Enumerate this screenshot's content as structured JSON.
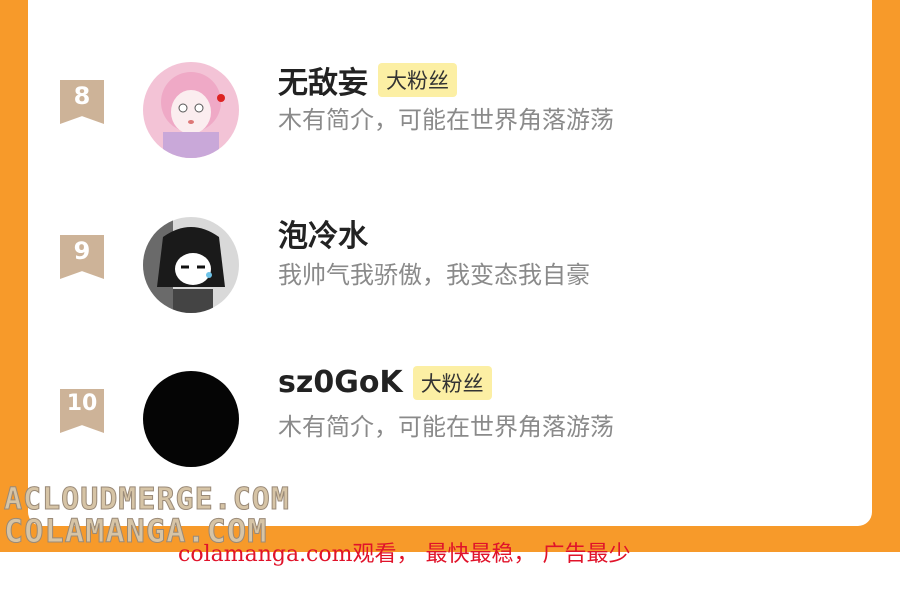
{
  "colors": {
    "frame": "#F79A2A",
    "badge": "#CDB398",
    "fan_tag_bg": "#FCEFA4",
    "ad_text": "#E0132A"
  },
  "fans": [
    {
      "rank": "8",
      "name": "无敌妄",
      "tag": "大粉丝",
      "bio": "木有简介，可能在世界角落游荡",
      "avatar_icon": "pink-anime-girl-avatar"
    },
    {
      "rank": "9",
      "name": "泡冷水",
      "tag": "",
      "bio": "我帅气我骄傲，我变态我自豪",
      "avatar_icon": "dark-hair-anime-avatar"
    },
    {
      "rank": "10",
      "name": "sz0GoK",
      "tag": "大粉丝",
      "bio": "木有简介，可能在世界角落游荡",
      "avatar_icon": "black-circle-avatar"
    }
  ],
  "watermark": {
    "line1": "ACLOUDMERGE.COM",
    "line2": "COLAMANGA.COM"
  },
  "ad": "colamanga.com观看， 最快最稳， 广告最少"
}
